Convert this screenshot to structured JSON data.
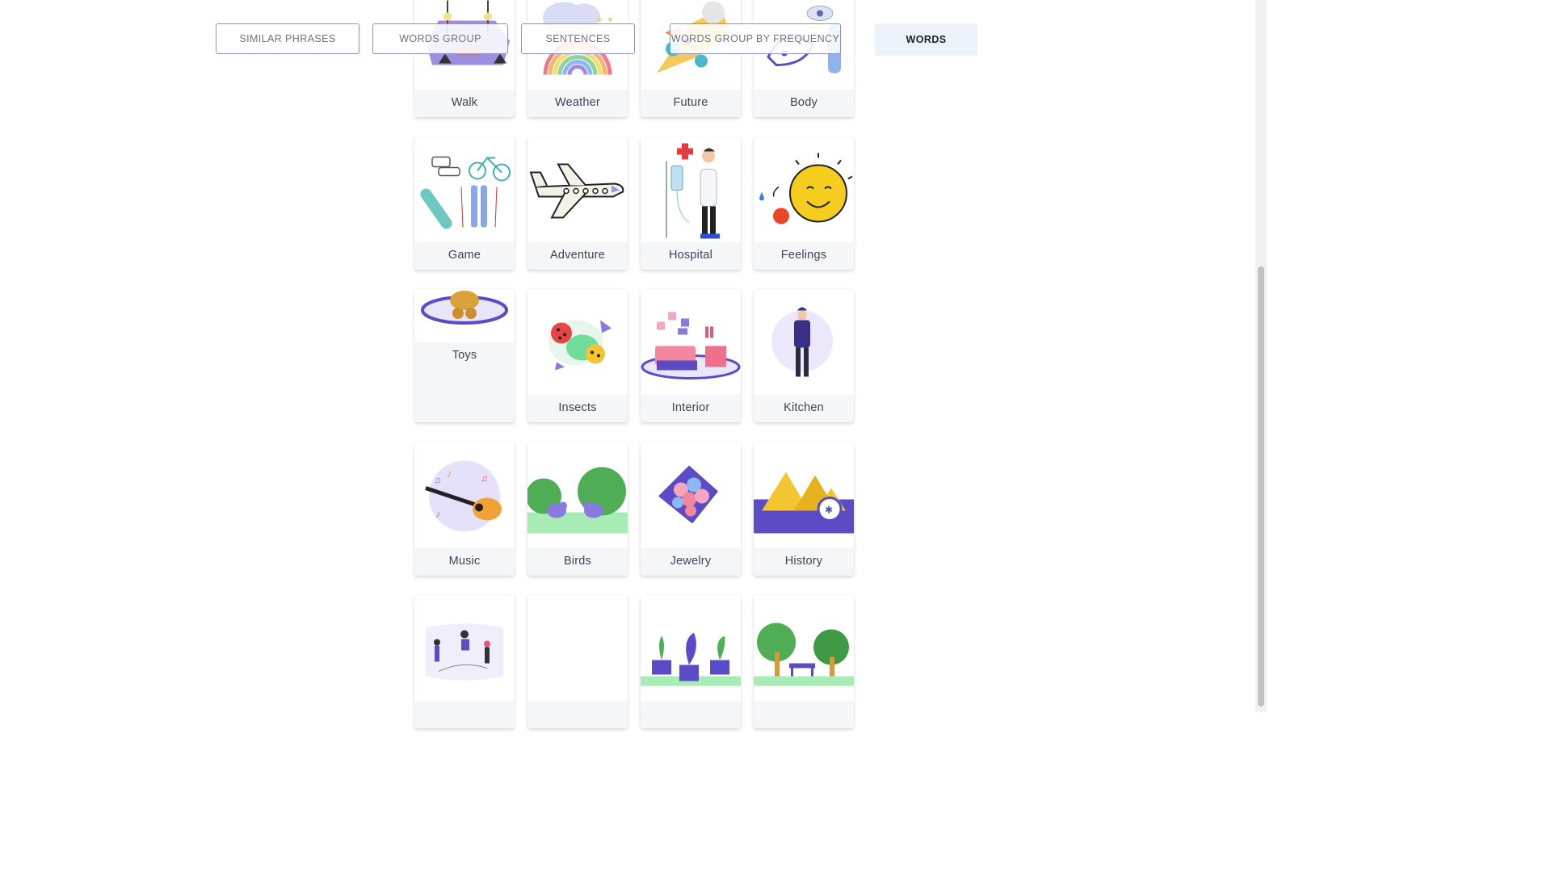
{
  "tabs": [
    {
      "label": "SIMILAR PHRASES"
    },
    {
      "label": "WORDS GROUP"
    },
    {
      "label": "SENTENCES"
    },
    {
      "label": "WORDS GROUP BY FREQUENCY"
    },
    {
      "label": "WORDS",
      "active": true
    }
  ],
  "cards": [
    {
      "label": "Walk"
    },
    {
      "label": "Weather"
    },
    {
      "label": "Future"
    },
    {
      "label": "Body"
    },
    {
      "label": "Game"
    },
    {
      "label": "Adventure"
    },
    {
      "label": "Hospital"
    },
    {
      "label": "Feelings"
    },
    {
      "label": "Toys"
    },
    {
      "label": "Insects"
    },
    {
      "label": "Interior"
    },
    {
      "label": "Kitchen"
    },
    {
      "label": "Music"
    },
    {
      "label": "Birds"
    },
    {
      "label": "Jewelry"
    },
    {
      "label": "History"
    },
    {
      "label": ""
    },
    {
      "label": ""
    },
    {
      "label": ""
    },
    {
      "label": ""
    }
  ],
  "colors": {
    "accent": "#5b4bc4",
    "tab_border": "#8a8fd6",
    "active_tab_bg": "#eef2fb"
  }
}
